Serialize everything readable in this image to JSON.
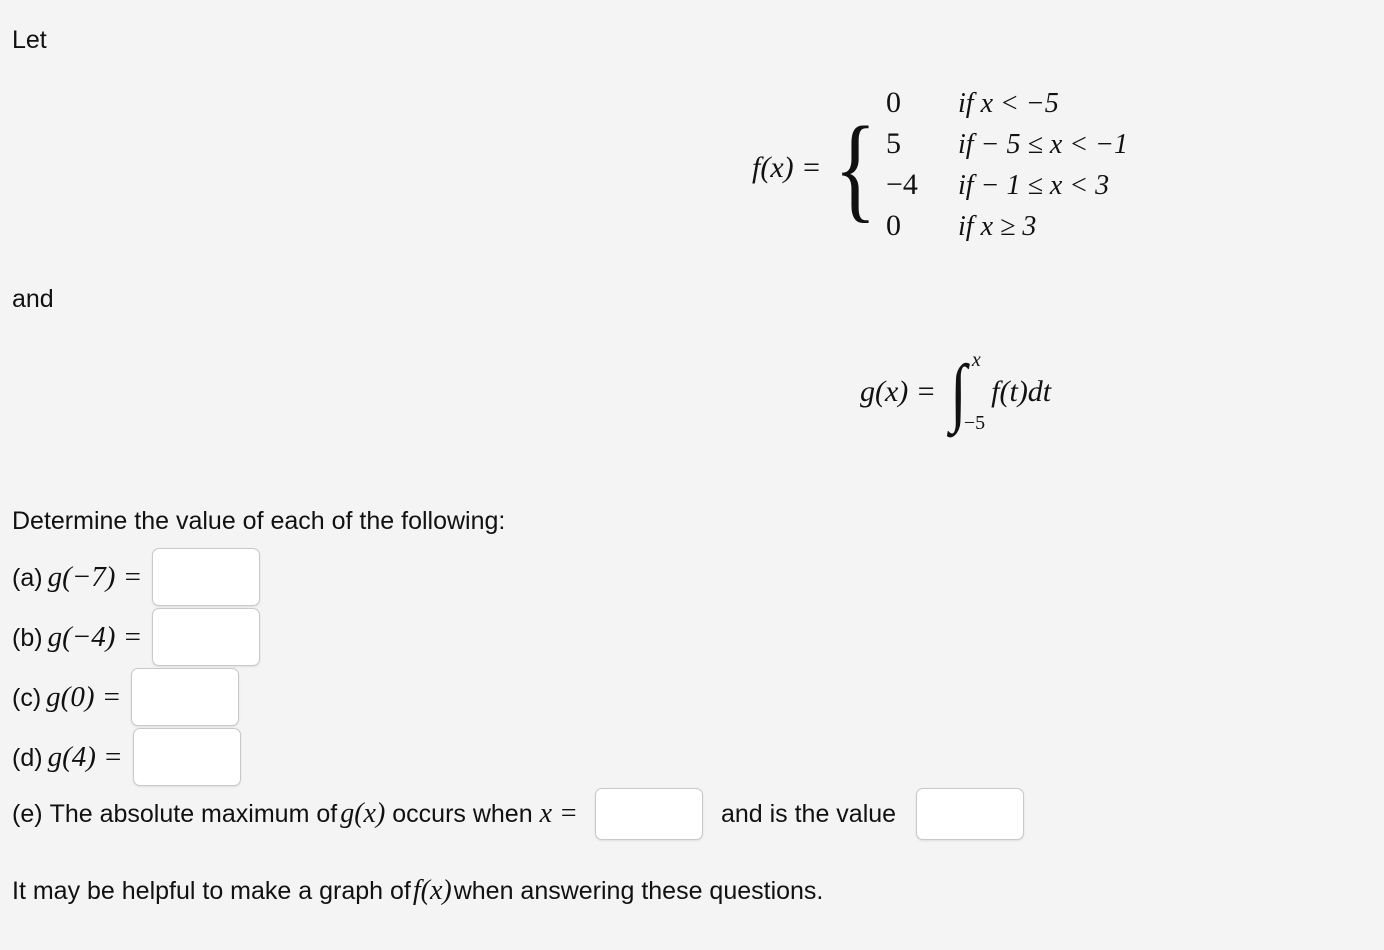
{
  "colors": {
    "background": "#f4f4f4",
    "text": "#111111",
    "input_border": "#c9c9c9",
    "input_fill": "#ffffff"
  },
  "intro": {
    "let_text": "Let",
    "and_text": "and"
  },
  "piecewise": {
    "lhs": "f(x) =",
    "brace": "{",
    "rows": [
      {
        "value": "0",
        "condition": "if x < −5"
      },
      {
        "value": "5",
        "condition": "if − 5 ≤ x < −1"
      },
      {
        "value": "−4",
        "condition": "if − 1 ≤ x < 3"
      },
      {
        "value": "0",
        "condition": "if x ≥ 3"
      }
    ]
  },
  "integral": {
    "lhs": "g(x) =",
    "sign": "∫",
    "upper_limit": "x",
    "lower_limit": "−5",
    "integrand": "f(t)dt"
  },
  "questions": {
    "heading": "Determine the value of each of the following:",
    "items": [
      {
        "tag": "(a)",
        "expr": "g(−7) =",
        "value": "",
        "placeholder": ""
      },
      {
        "tag": "(b)",
        "expr": "g(−4) =",
        "value": "",
        "placeholder": ""
      },
      {
        "tag": "(c)",
        "expr": "g(0) =",
        "value": "",
        "placeholder": ""
      },
      {
        "tag": "(d)",
        "expr": "g(4) =",
        "value": "",
        "placeholder": ""
      }
    ]
  },
  "part_e": {
    "tag": "(e)",
    "text_before": "The absolute maximum of",
    "func": "g(x)",
    "text_middle": "occurs when",
    "var": "x =",
    "x_value": "",
    "x_placeholder": "",
    "text_after": "and is the value",
    "max_value": "",
    "max_placeholder": ""
  },
  "hint": {
    "before": "It may be helpful to make a graph of",
    "func": "f(x)",
    "after": "when answering these questions."
  }
}
